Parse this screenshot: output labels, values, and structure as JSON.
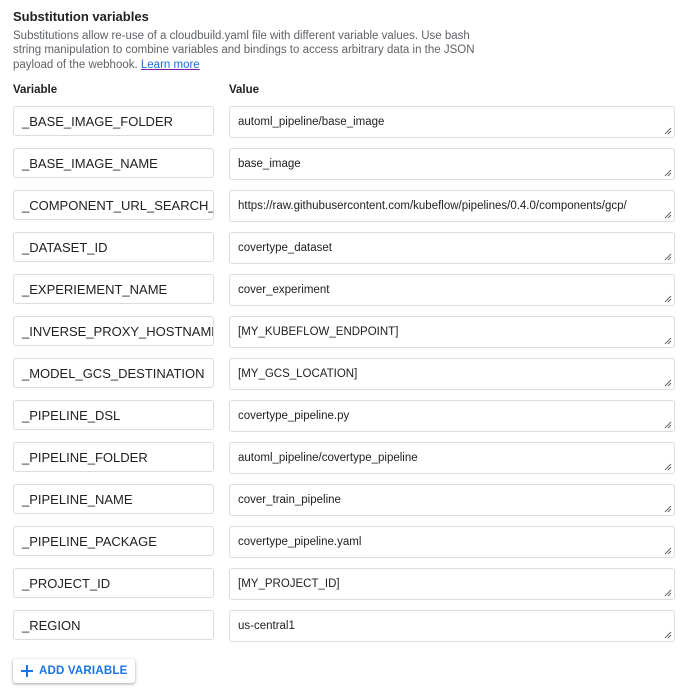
{
  "section": {
    "title": "Substitution variables",
    "description": "Substitutions allow re-use of a cloudbuild.yaml file with different variable values. Use bash string manipulation to combine variables and bindings to access arbitrary data in the JSON payload of the webhook.",
    "learn_more": "Learn more"
  },
  "columns": {
    "variable": "Variable",
    "value": "Value"
  },
  "rows": [
    {
      "variable": "_BASE_IMAGE_FOLDER",
      "value": "automl_pipeline/base_image"
    },
    {
      "variable": "_BASE_IMAGE_NAME",
      "value": "base_image"
    },
    {
      "variable": "_COMPONENT_URL_SEARCH_PREFIX",
      "value": "https://raw.githubusercontent.com/kubeflow/pipelines/0.4.0/components/gcp/"
    },
    {
      "variable": "_DATASET_ID",
      "value": "covertype_dataset"
    },
    {
      "variable": "_EXPERIEMENT_NAME",
      "value": "cover_experiment"
    },
    {
      "variable": "_INVERSE_PROXY_HOSTNAME",
      "value": "[MY_KUBEFLOW_ENDPOINT]"
    },
    {
      "variable": "_MODEL_GCS_DESTINATION",
      "value": "[MY_GCS_LOCATION]"
    },
    {
      "variable": "_PIPELINE_DSL",
      "value": "covertype_pipeline.py"
    },
    {
      "variable": "_PIPELINE_FOLDER",
      "value": "automl_pipeline/covertype_pipeline"
    },
    {
      "variable": "_PIPELINE_NAME",
      "value": "cover_train_pipeline"
    },
    {
      "variable": "_PIPELINE_PACKAGE",
      "value": "covertype_pipeline.yaml"
    },
    {
      "variable": "_PROJECT_ID",
      "value": "[MY_PROJECT_ID]"
    },
    {
      "variable": "_REGION",
      "value": "us-central1"
    }
  ],
  "add_button": {
    "label": "ADD VARIABLE",
    "icon": "plus-icon"
  },
  "colors": {
    "accent": "#1a73e8",
    "border": "#dadce0",
    "text": "#202124",
    "secondary_text": "#5f6368"
  }
}
